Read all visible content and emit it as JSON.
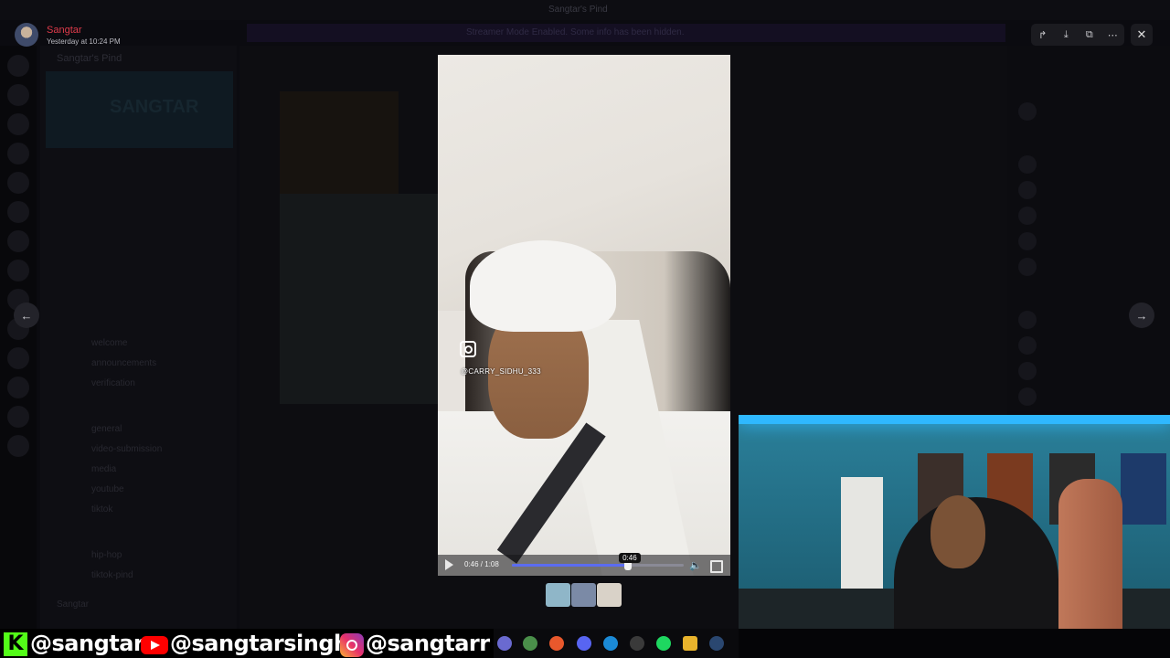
{
  "viewer": {
    "uploader_name": "Sangtar",
    "upload_time": "Yesterday at 10:24 PM",
    "toolbar_icons": [
      "forward-icon",
      "download-icon",
      "open-external-icon",
      "more-icon"
    ],
    "close_icon": "close-icon",
    "prev_icon": "arrow-left-icon",
    "next_icon": "arrow-right-icon"
  },
  "video": {
    "watermark_handle": "@CARRY_SIDHU_333",
    "time_readout": "0:46 / 1:08",
    "seek_tooltip": "0:46",
    "progress": 0.676
  },
  "thumbnails": {
    "colors": [
      "#8fb6c8",
      "#7b8aa6",
      "#d9d2c8"
    ]
  },
  "background_app": {
    "window_title": "Sangtar's Pind",
    "banner_text": "Streamer Mode Enabled. Some info has been hidden.",
    "server_name": "Sangtar's Pind",
    "server_banner_text": "SANGTAR",
    "channels": [
      "welcome",
      "announcements",
      "verification",
      "general",
      "video-submission",
      "media",
      "youtube",
      "tiktok",
      "hip-hop",
      "tiktok-pind",
      "stakepod"
    ],
    "user_name": "Sangtar"
  },
  "overlay": {
    "kick_handle": "@sangtar",
    "youtube_handle": "@sangtarsingh",
    "instagram_handle": "@sangtarr",
    "kick_letter": "K"
  },
  "colors": {
    "accent": "#5b6cf0",
    "uploader_name": "#e03b4b",
    "kick": "#53fc18",
    "youtube": "#ff0000"
  }
}
